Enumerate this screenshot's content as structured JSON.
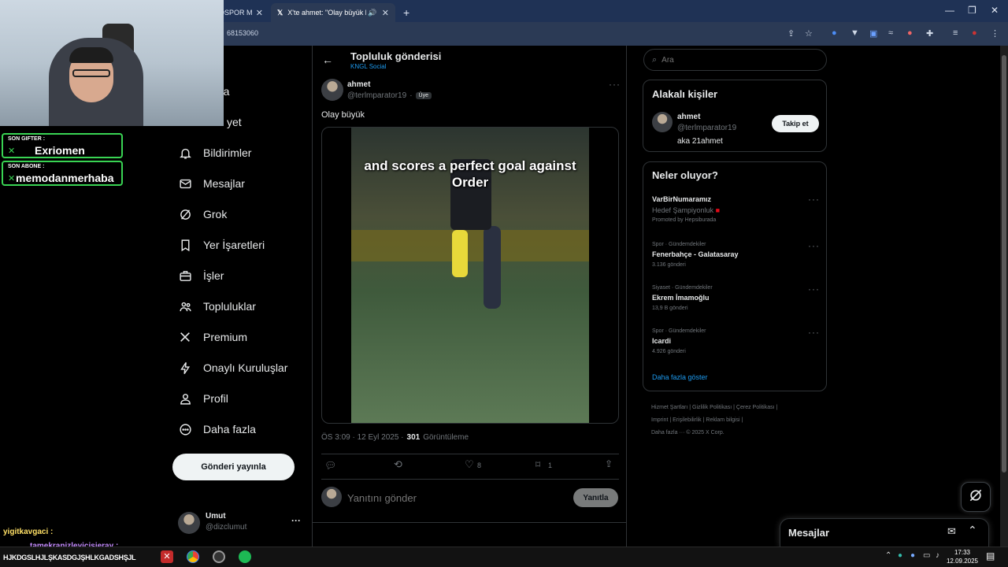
{
  "browser": {
    "tabs": [
      {
        "title": "OSPOR M",
        "active": false
      },
      {
        "title": "X'te ahmet: \"Olay büyük ht",
        "active": true
      }
    ],
    "new_tab": "+",
    "url_fragment": "68153060",
    "window_controls": {
      "minimize": "—",
      "restore": "❐",
      "close": "✕"
    }
  },
  "stream_overlay": {
    "gifter_label": "SON GIFTER :",
    "gifter_name": "Exriomen",
    "sub_label": "SON ABONE :",
    "sub_name": "memodanmerhaba",
    "chat": [
      {
        "user": "yigitkavgaci :",
        "text": "",
        "color": "#ffe066"
      },
      {
        "user": "tamekranizleyicisieray :",
        "text": "",
        "color": "#c58bff"
      },
      {
        "user": "",
        "text": "HJKDGSLHJLŞKASDGJŞHLKGADSHŞJL",
        "color": "#ffffff"
      }
    ],
    "nav_partial": [
      "sayfa",
      "yet"
    ]
  },
  "sidebar": {
    "items": [
      {
        "label": "Bildirimler",
        "icon": "bell-icon"
      },
      {
        "label": "Mesajlar",
        "icon": "mail-icon"
      },
      {
        "label": "Grok",
        "icon": "grok-icon"
      },
      {
        "label": "Yer İşaretleri",
        "icon": "bookmark-icon"
      },
      {
        "label": "İşler",
        "icon": "briefcase-icon"
      },
      {
        "label": "Topluluklar",
        "icon": "communities-icon"
      },
      {
        "label": "Premium",
        "icon": "x-logo-icon"
      },
      {
        "label": "Onaylı Kuruluşlar",
        "icon": "lightning-icon"
      },
      {
        "label": "Profil",
        "icon": "person-icon"
      },
      {
        "label": "Daha fazla",
        "icon": "more-circle-icon"
      }
    ],
    "post_button": "Gönderi yayınla",
    "account": {
      "name": "Umut",
      "handle": "@dizclumut",
      "more": "···"
    }
  },
  "post": {
    "header_title": "Topluluk gönderisi",
    "community": "KNGL Social",
    "author_name": "ahmet",
    "author_handle": "@terlmparator19",
    "separator": "·",
    "badge": "Üye",
    "text": "Olay büyük",
    "video_caption": "and scores a perfect goal against Order",
    "timestamp": "ÖS 3:09 · 12 Eyl 2025 ·",
    "views_count": "301",
    "views_label": "Görüntüleme",
    "actions": {
      "replies": "",
      "reposts": "",
      "likes": "8",
      "bookmarks": "1"
    },
    "reply_placeholder": "Yanıtını gönder",
    "reply_button": "Yanıtla"
  },
  "search": {
    "placeholder": "Ara"
  },
  "relevant": {
    "title": "Alakalı kişiler",
    "name": "ahmet",
    "handle": "@terlmparator19",
    "bio": "aka 21ahmet",
    "follow": "Takip et"
  },
  "trends": {
    "title": "Neler oluyor?",
    "promoted": {
      "name": "VarBirNumaramız",
      "sub": "Hedef Şampiyonluk",
      "by": "Promoted by Hepsiburada"
    },
    "items": [
      {
        "category": "Spor · Gündemdekiler",
        "name": "Fenerbahçe - Galatasaray",
        "count": "3.136 gönderi"
      },
      {
        "category": "Siyaset · Gündemdekiler",
        "name": "Ekrem İmamoğlu",
        "count": "13,9 B gönderi"
      },
      {
        "category": "Spor · Gündemdekiler",
        "name": "Icardi",
        "count": "4.926 gönderi"
      }
    ],
    "show_more": "Daha fazla göster"
  },
  "footer": {
    "links": [
      "Hizmet Şartları",
      "Gizlilik Politikası",
      "Çerez Politikası",
      "Imprint",
      "Erişilebilirlik",
      "Reklam bilgisi",
      "Daha fazla ···"
    ],
    "copyright": "© 2025 X Corp."
  },
  "messages_drawer": {
    "title": "Mesajlar"
  },
  "taskbar": {
    "time": "17:33",
    "date": "12.09.2025"
  },
  "colors": {
    "accent": "#1d9bf0",
    "overlay_green": "#39d353",
    "background": "#000000",
    "border": "#2f3336"
  }
}
